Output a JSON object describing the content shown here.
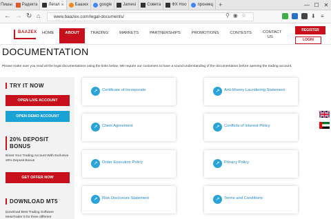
{
  "browser": {
    "first_tab_text": "Пишы",
    "tabs": [
      {
        "label": "Радекта",
        "active": false,
        "icon": "red-square-icon"
      },
      {
        "label": "Легал",
        "active": true,
        "icon": "megaphone-icon"
      },
      {
        "label": "Баазех",
        "active": false,
        "icon": "orange-circle-icon"
      },
      {
        "label": "google",
        "active": false,
        "icon": "google-icon"
      },
      {
        "label": "Jamesi",
        "active": false,
        "icon": "megaphone-icon"
      },
      {
        "label": "Совета",
        "active": false,
        "icon": "megaphone-icon"
      },
      {
        "label": "ФХ Ноо",
        "active": false,
        "icon": "megaphone-icon"
      },
      {
        "label": "проникц",
        "active": false,
        "icon": "google-icon"
      }
    ],
    "new_tab": "+",
    "window_controls": [
      "—",
      "☐",
      "✕"
    ],
    "url": "www.baazex.com/legal-documents/"
  },
  "header": {
    "logo": "BAAZEX",
    "menu": [
      "HOME",
      "ABOUT",
      "TRADING",
      "MARKETS",
      "PARTNERSHIPS",
      "PROMOTIONS",
      "CONTESTS",
      "CONTACT US"
    ],
    "active_menu": "ABOUT",
    "register": "REGISTER",
    "login": "LOGIN"
  },
  "page": {
    "title": "DOCUMENTATION",
    "intro": "Please make sure you read all the legal documentations using the links below. We require our customers to have a sound understanding of the documentation before opening the trading account."
  },
  "sidebar": {
    "try_title": "TRY IT NOW",
    "open_live": "OPEN LIVE ACCOUNT",
    "open_demo": "OPEN DEMO ACCOUNT",
    "bonus_title": "20% DEPOSIT BONUS",
    "bonus_text": "Boost Your Trading Account With Exclusive 20% Deposit Bonus",
    "get_offer": "GET OFFER NOW",
    "mt5_title": "DOWNLOAD MT5",
    "mt5_text": "Download Best Trading Software MetaTrader 5 for three different"
  },
  "documents": [
    "Certificate of Incorporate",
    "Anti-Money Laundering Statement",
    "Client Agreement",
    "Conflicts of Interest Policy",
    "Order Execution Policy",
    "Privacy Policy",
    "Risk Disclosure Statement",
    "Terms and Conditions"
  ],
  "colors": {
    "brand_red": "#c8101c",
    "accent_blue": "#1aa1d6",
    "link_blue": "#1e88c8"
  },
  "flags": [
    "uk-flag-icon",
    "uae-flag-icon"
  ]
}
